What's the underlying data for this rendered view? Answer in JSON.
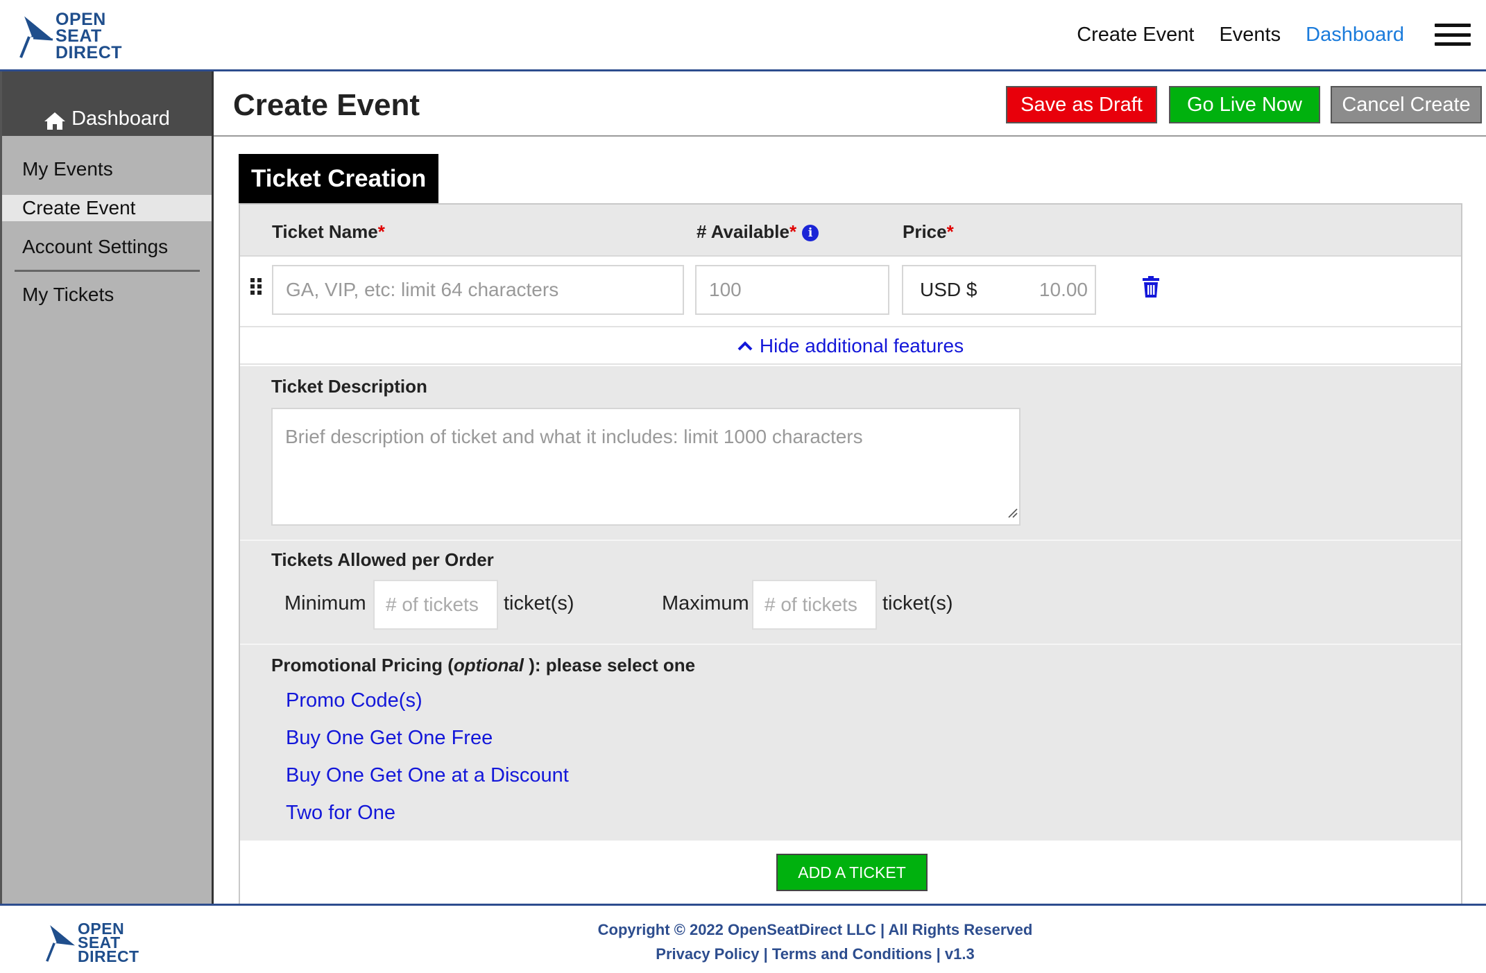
{
  "brand": {
    "logo_lines": [
      "OPEN",
      "SEAT",
      "DIRECT"
    ],
    "color": "#1f4e8c"
  },
  "topnav": {
    "items": [
      "Create Event",
      "Events",
      "Dashboard"
    ],
    "active": "Dashboard"
  },
  "sidebar": {
    "dashboard_label": "Dashboard",
    "items": [
      "My Events",
      "Create Event",
      "Account Settings"
    ],
    "active": "Create Event",
    "extra_items": [
      "My Tickets"
    ]
  },
  "page": {
    "title": "Create Event",
    "buttons": {
      "draft": "Save as Draft",
      "live": "Go Live Now",
      "cancel": "Cancel Create"
    }
  },
  "ticket": {
    "section_title": "Ticket Creation",
    "columns": {
      "name": "Ticket Name",
      "available": "# Available",
      "price": "Price",
      "required_mark": "*"
    },
    "name_placeholder": "GA, VIP, etc: limit 64 characters",
    "available_placeholder": "100",
    "price_currency": "USD $",
    "price_placeholder": "10.00",
    "hide_features": "Hide additional features",
    "description_label": "Ticket Description",
    "description_placeholder": "Brief description of ticket and what it includes: limit 1000 characters",
    "per_order_label": "Tickets Allowed per Order",
    "minimum_label": "Minimum",
    "maximum_label": "Maximum",
    "count_placeholder": "# of tickets",
    "tickets_suffix": "ticket(s)",
    "promo_label_pre": "Promotional Pricing (",
    "promo_label_optional": "optional",
    "promo_label_post": " ): please select one",
    "promo_options": [
      "Promo Code(s)",
      "Buy One Get One Free",
      "Buy One Get One at a Discount",
      "Two for One"
    ],
    "add_button": "ADD A TICKET"
  },
  "footer": {
    "copyright": "Copyright © 2022 OpenSeatDirect LLC | All Rights Reserved",
    "privacy": "Privacy Policy",
    "terms": "Terms and Conditions",
    "version": "v1.3",
    "separator": "|"
  },
  "colors": {
    "draft": "#e8000b",
    "live": "#00b10e",
    "cancel": "#8c8c8c",
    "link": "#1317d9",
    "accent": "#1a7bdb"
  },
  "icons": [
    "home-icon",
    "info-icon",
    "drag-handle-icon",
    "trash-icon",
    "chevron-up-icon",
    "menu-icon",
    "resize-handle-icon"
  ]
}
